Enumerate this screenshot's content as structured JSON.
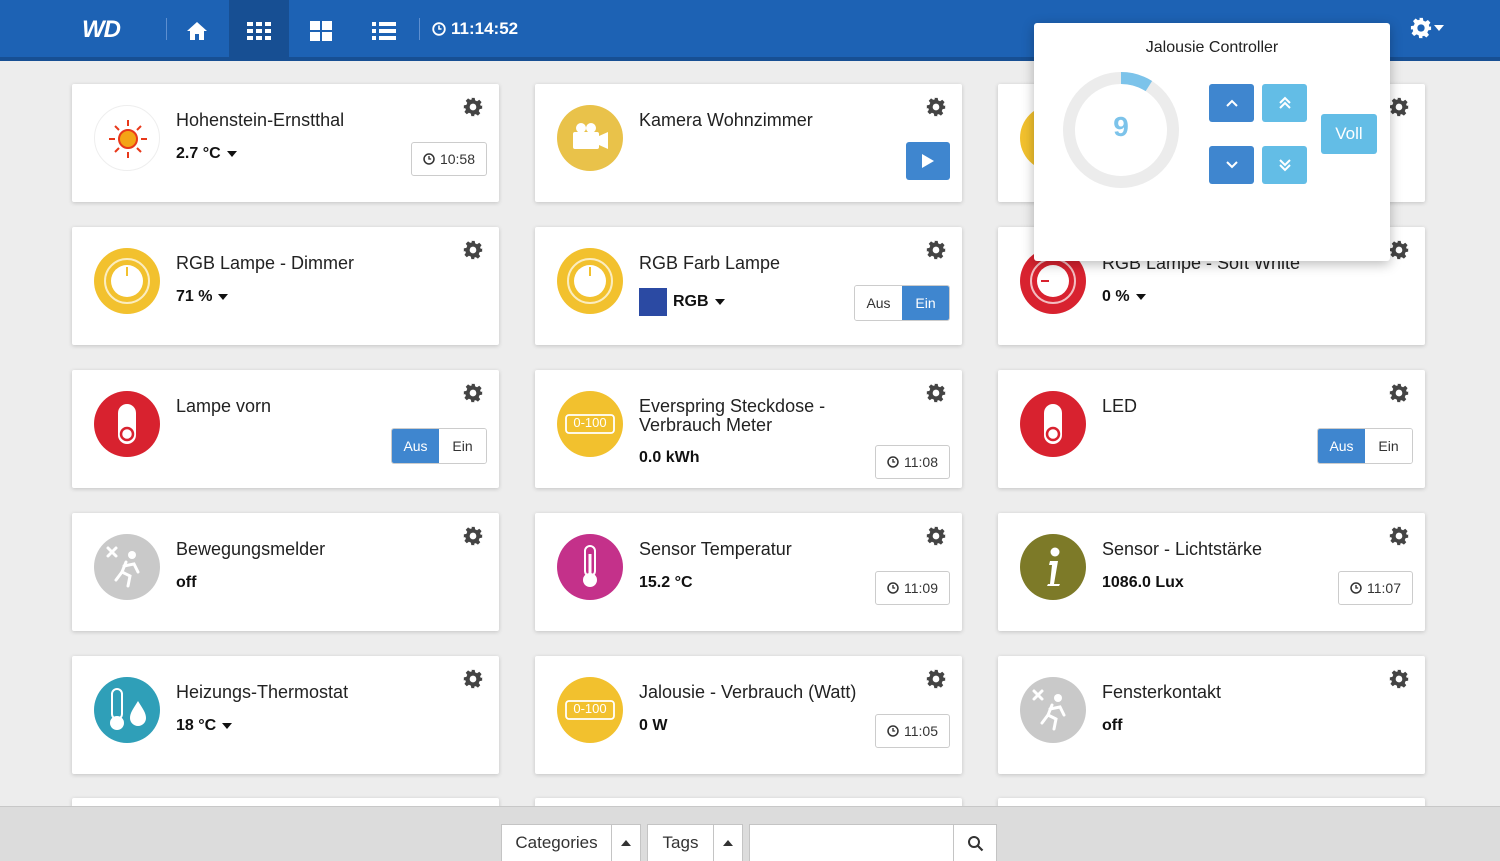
{
  "header": {
    "logo": "WD",
    "clock": "11:14:52",
    "nav": [
      "home-icon",
      "grid-icon",
      "tiles-icon",
      "list-icon"
    ]
  },
  "colors": {
    "header": "#1d62b4",
    "accent": "#3f86cf",
    "accent_light": "#63bde6",
    "yellow": "#f2c12e",
    "red": "#d8222f",
    "magenta": "#c4318a",
    "olive": "#7d7a28",
    "teal": "#2f9fb8",
    "grey": "#c9c9c9"
  },
  "cards": [
    {
      "title": "Hohenstein-Ernstthal",
      "value": "2.7 °C",
      "time": "10:58",
      "icon": "sun-icon"
    },
    {
      "title": "Kamera Wohnzimmer",
      "icon": "camera-icon"
    },
    {
      "title": "",
      "icon": "yellow-icon"
    },
    {
      "title": "RGB Lampe - Dimmer",
      "value": "71 %",
      "icon": "dimmer-icon"
    },
    {
      "title": "RGB Farb Lampe",
      "value": "RGB",
      "off": "Aus",
      "on": "Ein",
      "icon": "dimmer-icon"
    },
    {
      "title": "RGB Lampe - Soft White",
      "value": "0 %",
      "icon": "dimmer-icon"
    },
    {
      "title": "Lampe vorn",
      "off": "Aus",
      "on": "Ein",
      "icon": "switch-icon"
    },
    {
      "title": "Everspring Steckdose - Verbrauch Meter",
      "value": "0.0 kWh",
      "time": "11:08",
      "icon": "meter-icon",
      "meter": "0-100"
    },
    {
      "title": "LED",
      "off": "Aus",
      "on": "Ein",
      "icon": "switch-icon"
    },
    {
      "title": "Bewegungsmelder",
      "value": "off",
      "icon": "motion-icon"
    },
    {
      "title": "Sensor Temperatur",
      "value": "15.2 °C",
      "time": "11:09",
      "icon": "thermometer-icon"
    },
    {
      "title": "Sensor - Lichtstärke",
      "value": "1086.0 Lux",
      "time": "11:07",
      "icon": "info-icon"
    },
    {
      "title": "Heizungs-Thermostat",
      "value": "18 °C",
      "icon": "thermostat-icon"
    },
    {
      "title": "Jalousie - Verbrauch (Watt)",
      "value": "0 W",
      "time": "11:05",
      "icon": "meter-icon",
      "meter": "0-100"
    },
    {
      "title": "Fensterkontakt",
      "value": "off",
      "icon": "motion-icon"
    }
  ],
  "popup": {
    "title": "Jalousie Controller",
    "level": "9",
    "level_fraction": 0.09,
    "full_label": "Voll"
  },
  "bottom": {
    "categories": "Categories",
    "tags": "Tags",
    "search_placeholder": ""
  }
}
